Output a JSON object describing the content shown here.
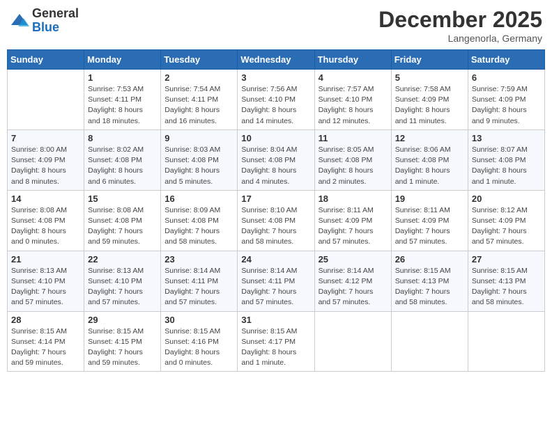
{
  "header": {
    "logo_general": "General",
    "logo_blue": "Blue",
    "month_title": "December 2025",
    "location": "Langenorla, Germany"
  },
  "weekdays": [
    "Sunday",
    "Monday",
    "Tuesday",
    "Wednesday",
    "Thursday",
    "Friday",
    "Saturday"
  ],
  "weeks": [
    [
      {
        "day": "",
        "info": ""
      },
      {
        "day": "1",
        "info": "Sunrise: 7:53 AM\nSunset: 4:11 PM\nDaylight: 8 hours\nand 18 minutes."
      },
      {
        "day": "2",
        "info": "Sunrise: 7:54 AM\nSunset: 4:11 PM\nDaylight: 8 hours\nand 16 minutes."
      },
      {
        "day": "3",
        "info": "Sunrise: 7:56 AM\nSunset: 4:10 PM\nDaylight: 8 hours\nand 14 minutes."
      },
      {
        "day": "4",
        "info": "Sunrise: 7:57 AM\nSunset: 4:10 PM\nDaylight: 8 hours\nand 12 minutes."
      },
      {
        "day": "5",
        "info": "Sunrise: 7:58 AM\nSunset: 4:09 PM\nDaylight: 8 hours\nand 11 minutes."
      },
      {
        "day": "6",
        "info": "Sunrise: 7:59 AM\nSunset: 4:09 PM\nDaylight: 8 hours\nand 9 minutes."
      }
    ],
    [
      {
        "day": "7",
        "info": "Sunrise: 8:00 AM\nSunset: 4:09 PM\nDaylight: 8 hours\nand 8 minutes."
      },
      {
        "day": "8",
        "info": "Sunrise: 8:02 AM\nSunset: 4:08 PM\nDaylight: 8 hours\nand 6 minutes."
      },
      {
        "day": "9",
        "info": "Sunrise: 8:03 AM\nSunset: 4:08 PM\nDaylight: 8 hours\nand 5 minutes."
      },
      {
        "day": "10",
        "info": "Sunrise: 8:04 AM\nSunset: 4:08 PM\nDaylight: 8 hours\nand 4 minutes."
      },
      {
        "day": "11",
        "info": "Sunrise: 8:05 AM\nSunset: 4:08 PM\nDaylight: 8 hours\nand 2 minutes."
      },
      {
        "day": "12",
        "info": "Sunrise: 8:06 AM\nSunset: 4:08 PM\nDaylight: 8 hours\nand 1 minute."
      },
      {
        "day": "13",
        "info": "Sunrise: 8:07 AM\nSunset: 4:08 PM\nDaylight: 8 hours\nand 1 minute."
      }
    ],
    [
      {
        "day": "14",
        "info": "Sunrise: 8:08 AM\nSunset: 4:08 PM\nDaylight: 8 hours\nand 0 minutes."
      },
      {
        "day": "15",
        "info": "Sunrise: 8:08 AM\nSunset: 4:08 PM\nDaylight: 7 hours\nand 59 minutes."
      },
      {
        "day": "16",
        "info": "Sunrise: 8:09 AM\nSunset: 4:08 PM\nDaylight: 7 hours\nand 58 minutes."
      },
      {
        "day": "17",
        "info": "Sunrise: 8:10 AM\nSunset: 4:08 PM\nDaylight: 7 hours\nand 58 minutes."
      },
      {
        "day": "18",
        "info": "Sunrise: 8:11 AM\nSunset: 4:09 PM\nDaylight: 7 hours\nand 57 minutes."
      },
      {
        "day": "19",
        "info": "Sunrise: 8:11 AM\nSunset: 4:09 PM\nDaylight: 7 hours\nand 57 minutes."
      },
      {
        "day": "20",
        "info": "Sunrise: 8:12 AM\nSunset: 4:09 PM\nDaylight: 7 hours\nand 57 minutes."
      }
    ],
    [
      {
        "day": "21",
        "info": "Sunrise: 8:13 AM\nSunset: 4:10 PM\nDaylight: 7 hours\nand 57 minutes."
      },
      {
        "day": "22",
        "info": "Sunrise: 8:13 AM\nSunset: 4:10 PM\nDaylight: 7 hours\nand 57 minutes."
      },
      {
        "day": "23",
        "info": "Sunrise: 8:14 AM\nSunset: 4:11 PM\nDaylight: 7 hours\nand 57 minutes."
      },
      {
        "day": "24",
        "info": "Sunrise: 8:14 AM\nSunset: 4:11 PM\nDaylight: 7 hours\nand 57 minutes."
      },
      {
        "day": "25",
        "info": "Sunrise: 8:14 AM\nSunset: 4:12 PM\nDaylight: 7 hours\nand 57 minutes."
      },
      {
        "day": "26",
        "info": "Sunrise: 8:15 AM\nSunset: 4:13 PM\nDaylight: 7 hours\nand 58 minutes."
      },
      {
        "day": "27",
        "info": "Sunrise: 8:15 AM\nSunset: 4:13 PM\nDaylight: 7 hours\nand 58 minutes."
      }
    ],
    [
      {
        "day": "28",
        "info": "Sunrise: 8:15 AM\nSunset: 4:14 PM\nDaylight: 7 hours\nand 59 minutes."
      },
      {
        "day": "29",
        "info": "Sunrise: 8:15 AM\nSunset: 4:15 PM\nDaylight: 7 hours\nand 59 minutes."
      },
      {
        "day": "30",
        "info": "Sunrise: 8:15 AM\nSunset: 4:16 PM\nDaylight: 8 hours\nand 0 minutes."
      },
      {
        "day": "31",
        "info": "Sunrise: 8:15 AM\nSunset: 4:17 PM\nDaylight: 8 hours\nand 1 minute."
      },
      {
        "day": "",
        "info": ""
      },
      {
        "day": "",
        "info": ""
      },
      {
        "day": "",
        "info": ""
      }
    ]
  ]
}
